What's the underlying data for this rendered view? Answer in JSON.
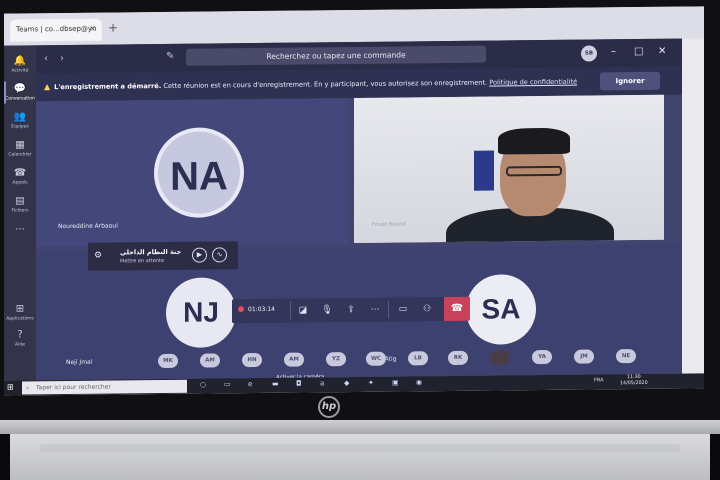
{
  "browser": {
    "tab_title": "Teams | co...dbsep@yn",
    "tab_close": "×",
    "new_tab": "+"
  },
  "rail": {
    "items": [
      {
        "label": "Activité",
        "icon": "bell-icon",
        "glyph": "🔔"
      },
      {
        "label": "Conversation",
        "icon": "chat-icon",
        "glyph": "💬"
      },
      {
        "label": "Équipes",
        "icon": "teams-icon",
        "glyph": "👥"
      },
      {
        "label": "Calendrier",
        "icon": "calendar-icon",
        "glyph": "▦"
      },
      {
        "label": "Appels",
        "icon": "phone-icon",
        "glyph": "☎"
      },
      {
        "label": "Fichiers",
        "icon": "file-icon",
        "glyph": "▤"
      },
      {
        "label": "...",
        "icon": "more-icon",
        "glyph": ""
      },
      {
        "label": "Applications",
        "icon": "apps-icon",
        "glyph": "⊞"
      },
      {
        "label": "Aide",
        "icon": "help-icon",
        "glyph": "?"
      }
    ]
  },
  "titlebar": {
    "search_placeholder": "Recherchez ou tapez une commande",
    "avatar": "SB"
  },
  "banner": {
    "bold": "L'enregistrement a démarré.",
    "text": " Cette réunion est en cours d'enregistrement. En y participant, vous autorisez son enregistrement. ",
    "link": "Politique de confidentialité",
    "ignore": "Ignorer"
  },
  "mini_call": {
    "title": "جنة النظام الداخلي",
    "status": "Mettre en attente"
  },
  "participants": {
    "na": {
      "initials": "NA",
      "name": "Noureddine Arbaoui"
    },
    "nj": {
      "initials": "NJ",
      "name": "Neji Jmal"
    },
    "sa": {
      "initials": "SA",
      "name": "Sahbi Atig"
    },
    "camera_name": "Foued Bouzid"
  },
  "controls": {
    "tooltip": "Activer la caméra",
    "timer": "01:03:14"
  },
  "overflow": [
    "MK",
    "AM",
    "HN",
    "AM",
    "YZ",
    "WC",
    "LB",
    "RK",
    "",
    "YA",
    "JM",
    "NE"
  ],
  "taskbar": {
    "search": "Taper ici pour rechercher",
    "lang": "FRA",
    "time": "11:30",
    "date": "14/05/2020"
  },
  "colors": {
    "teams_purple": "#3a3d66",
    "hangup_red": "#c7425a",
    "recording_red": "#e54b57"
  }
}
